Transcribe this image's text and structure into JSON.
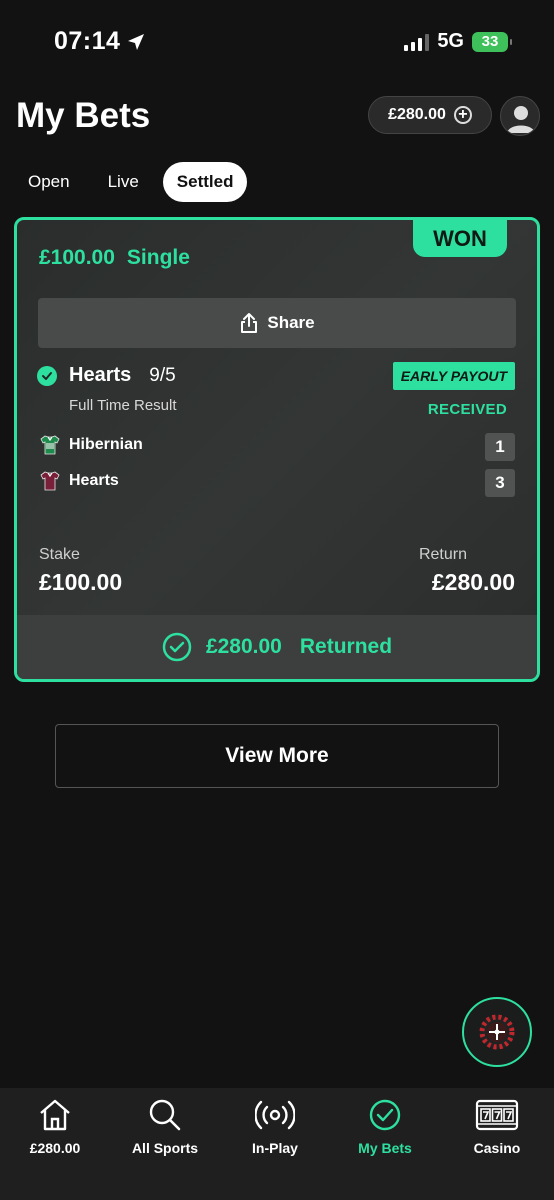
{
  "status_bar": {
    "time": "07:14",
    "network": "5G",
    "battery": "33"
  },
  "header": {
    "title": "My Bets",
    "balance": "£280.00"
  },
  "tabs": [
    {
      "label": "Open"
    },
    {
      "label": "Live"
    },
    {
      "label": "Settled",
      "active": true
    }
  ],
  "bet": {
    "result_badge": "WON",
    "stake_amount": "£100.00",
    "bet_type": "Single",
    "share_label": "Share",
    "selection": {
      "name": "Hearts",
      "odds": "9/5",
      "market": "Full Time Result"
    },
    "early_payout": "EARLY PAYOUT",
    "received": "RECEIVED",
    "teams": [
      {
        "name": "Hibernian",
        "score": "1"
      },
      {
        "name": "Hearts",
        "score": "3"
      }
    ],
    "stake_label": "Stake",
    "stake_value": "£100.00",
    "return_label": "Return",
    "return_value": "£280.00",
    "returned_amount": "£280.00",
    "returned_label": "Returned"
  },
  "view_more": "View More",
  "bottom_nav": [
    {
      "label": "£280.00",
      "icon": "home-icon"
    },
    {
      "label": "All Sports",
      "icon": "search-icon"
    },
    {
      "label": "In-Play",
      "icon": "broadcast-icon"
    },
    {
      "label": "My Bets",
      "icon": "check-circle-icon",
      "active": true
    },
    {
      "label": "Casino",
      "icon": "slot-machine-icon"
    }
  ],
  "colors": {
    "accent": "#2de0a0",
    "background": "#121212",
    "card": "#303332",
    "nav": "#1f1f1f"
  }
}
